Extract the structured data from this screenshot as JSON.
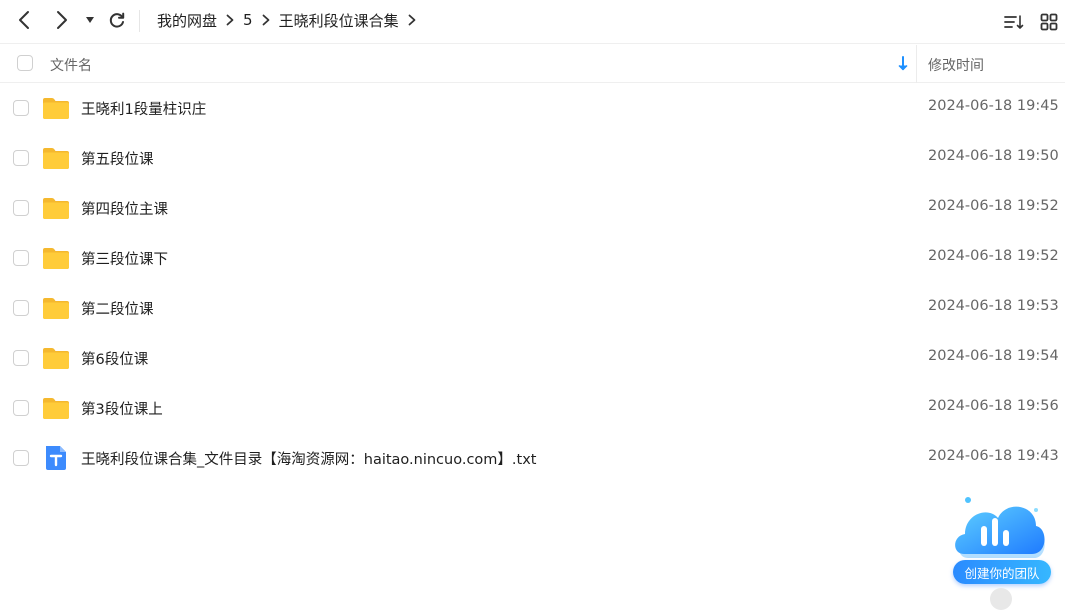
{
  "toolbar": {
    "back_icon": "chevron-left-icon",
    "forward_icon": "chevron-right-icon",
    "history_icon": "caret-down-icon",
    "refresh_icon": "refresh-icon",
    "sort_icon": "sort-list-icon",
    "grid_icon": "grid-view-icon"
  },
  "breadcrumb": {
    "items": [
      "我的网盘",
      "5",
      "王晓利段位课合集"
    ]
  },
  "header": {
    "name_label": "文件名",
    "time_label": "修改时间",
    "sort_direction": "descending",
    "accent_color": "#1e90ff"
  },
  "files": [
    {
      "name": "王晓利1段量柱识庄",
      "time": "2024-06-18 19:45",
      "type": "folder"
    },
    {
      "name": "第五段位课",
      "time": "2024-06-18 19:50",
      "type": "folder"
    },
    {
      "name": "第四段位主课",
      "time": "2024-06-18 19:52",
      "type": "folder"
    },
    {
      "name": "第三段位课下",
      "time": "2024-06-18 19:52",
      "type": "folder"
    },
    {
      "name": "第二段位课",
      "time": "2024-06-18 19:53",
      "type": "folder"
    },
    {
      "name": "第6段位课",
      "time": "2024-06-18 19:54",
      "type": "folder"
    },
    {
      "name": "第3段位课上",
      "time": "2024-06-18 19:56",
      "type": "folder"
    },
    {
      "name": "王晓利段位课合集_文件目录【海淘资源网：haitao.nincuo.com】.txt",
      "time": "2024-06-18 19:43",
      "type": "txt"
    }
  ],
  "promo": {
    "label": "创建你的团队",
    "icon": "cloud-chart-icon"
  },
  "colors": {
    "folder": "#ffc933",
    "txt_icon": "#3d8bfd",
    "promo": "#2b8bff"
  }
}
